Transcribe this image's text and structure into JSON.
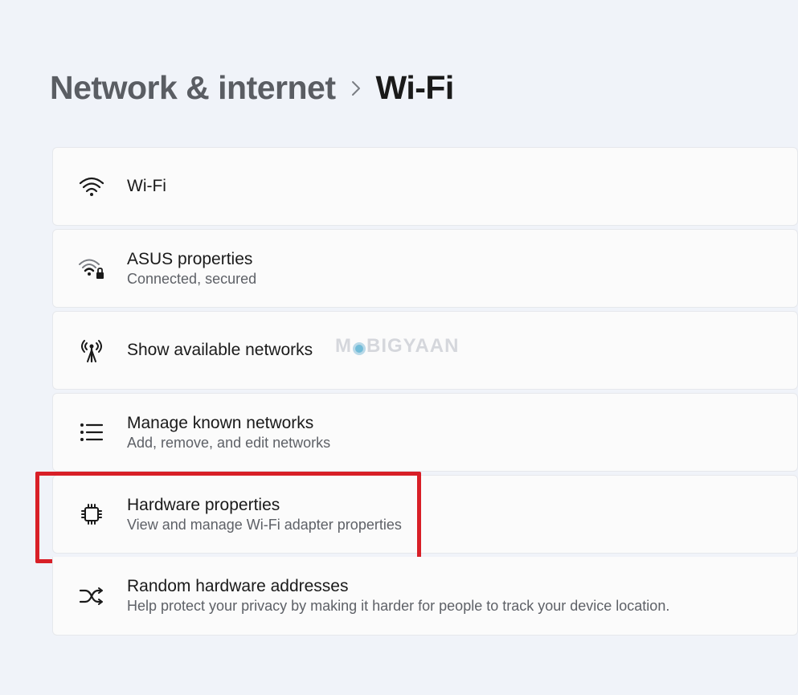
{
  "breadcrumb": {
    "parent": "Network & internet",
    "current": "Wi-Fi"
  },
  "watermark": {
    "prefix": "M",
    "suffix": "BIGYAAN"
  },
  "items": [
    {
      "title": "Wi-Fi",
      "subtitle": ""
    },
    {
      "title": "ASUS properties",
      "subtitle": "Connected, secured"
    },
    {
      "title": "Show available networks",
      "subtitle": ""
    },
    {
      "title": "Manage known networks",
      "subtitle": "Add, remove, and edit networks"
    },
    {
      "title": "Hardware properties",
      "subtitle": "View and manage Wi-Fi adapter properties"
    },
    {
      "title": "Random hardware addresses",
      "subtitle": "Help protect your privacy by making it harder for people to track your device location."
    }
  ]
}
